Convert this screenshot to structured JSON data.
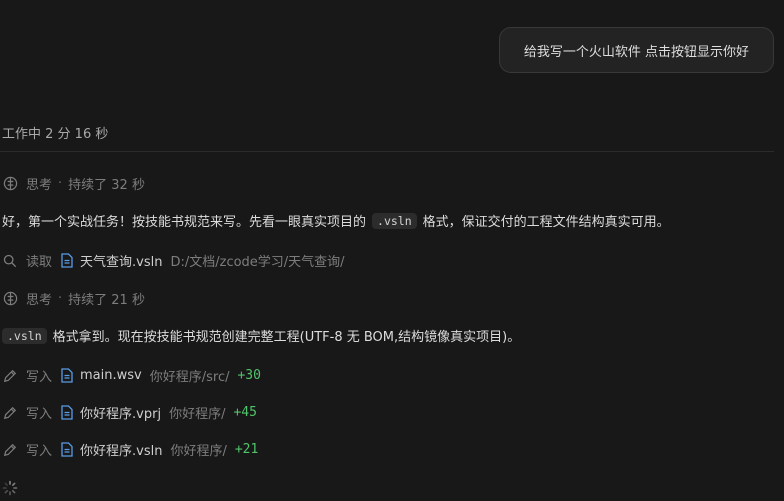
{
  "user_message": "给我写一个火山软件 点击按钮显示你好",
  "status": "工作中 2 分 16 秒",
  "thinking1": {
    "label": "思考",
    "separator": "·",
    "duration": "持续了 32 秒"
  },
  "para1": {
    "before": "好，第一个实战任务！按技能书规范来写。先看一眼真实项目的",
    "code": ".vsln",
    "after": "格式，保证交付的工程文件结构真实可用。"
  },
  "read": {
    "label": "读取",
    "file": "天气查询.vsln",
    "path": "D:/文档/zcode学习/天气查询/"
  },
  "thinking2": {
    "label": "思考",
    "separator": "·",
    "duration": "持续了 21 秒"
  },
  "para2": {
    "code": ".vsln",
    "after": "格式拿到。现在按技能书规范创建完整工程(UTF-8 无 BOM,结构镜像真实项目)。"
  },
  "writes": [
    {
      "label": "写入",
      "file": "main.wsv",
      "path": "你好程序/src/",
      "added": "+30"
    },
    {
      "label": "写入",
      "file": "你好程序.vprj",
      "path": "你好程序/",
      "added": "+45"
    },
    {
      "label": "写入",
      "file": "你好程序.vsln",
      "path": "你好程序/",
      "added": "+21"
    }
  ],
  "icons": {
    "thinking": "brain-icon",
    "read": "search-icon",
    "write": "pencil-icon",
    "file": "document-icon",
    "loading": "spinner-icon"
  },
  "colors": {
    "background": "#181818",
    "added": "#52c36b",
    "file_icon": "#5a9be6"
  }
}
